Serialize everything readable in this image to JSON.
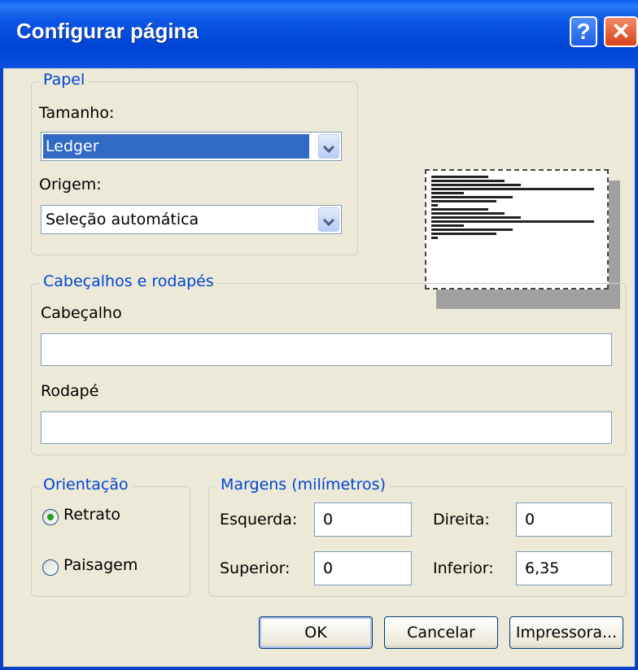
{
  "window": {
    "title": "Configurar página"
  },
  "paper": {
    "legend": "Papel",
    "size_label": "Tamanho:",
    "size_value": "Ledger",
    "source_label": "Origem:",
    "source_value": "Seleção automática"
  },
  "headers": {
    "legend": "Cabeçalhos e rodapés",
    "header_label": "Cabeçalho",
    "header_value": "",
    "footer_label": "Rodapé",
    "footer_value": ""
  },
  "orientation": {
    "legend": "Orientação",
    "portrait_label": "Retrato",
    "landscape_label": "Paisagem",
    "selected": "Retrato"
  },
  "margins": {
    "legend": "Margens (milímetros)",
    "left_label": "Esquerda:",
    "left_value": "0",
    "right_label": "Direita:",
    "right_value": "0",
    "top_label": "Superior:",
    "top_value": "0",
    "bottom_label": "Inferior:",
    "bottom_value": "6,35"
  },
  "buttons": {
    "ok": "OK",
    "cancel": "Cancelar",
    "printer": "Impressora..."
  },
  "colors": {
    "title_bar": "#0842c8",
    "group_legend": "#0046d5",
    "dialog_bg": "#ece9d8",
    "selection": "#316ac5"
  }
}
